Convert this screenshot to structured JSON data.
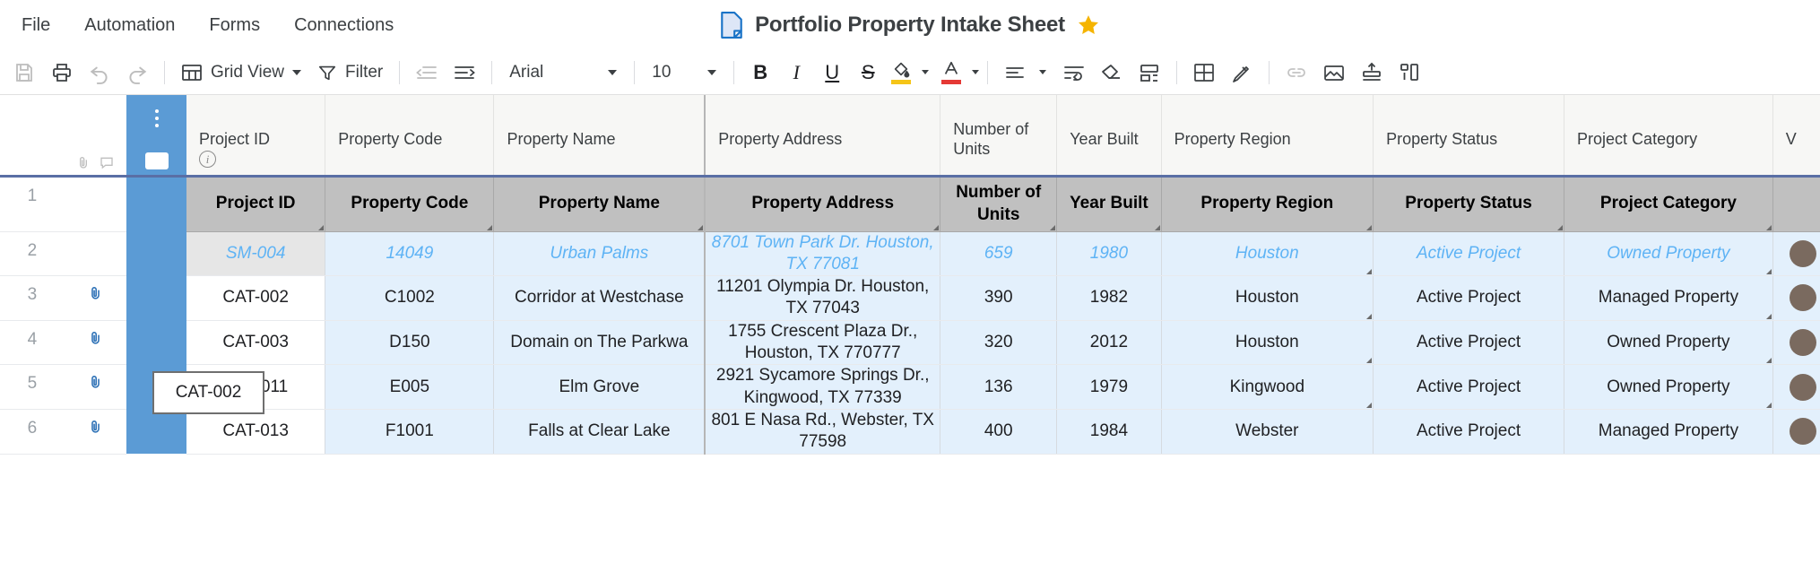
{
  "menu": {
    "items": [
      "File",
      "Automation",
      "Forms",
      "Connections"
    ]
  },
  "document": {
    "title": "Portfolio Property Intake Sheet",
    "icon": "document-icon",
    "starred_icon": "star-icon",
    "star_color": "#f5b400"
  },
  "toolbar": {
    "save_icon": "save-icon",
    "print_icon": "print-icon",
    "undo_icon": "undo-icon",
    "redo_icon": "redo-icon",
    "view_label": "Grid View",
    "view_icon": "grid-view-icon",
    "filter_label": "Filter",
    "filter_icon": "filter-icon",
    "indent_decrease_icon": "indent-decrease-icon",
    "indent_increase_icon": "indent-increase-icon",
    "font_family": "Arial",
    "font_size": "10",
    "bold_label": "B",
    "italic_label": "I",
    "underline_label": "U",
    "strikethrough_label": "S",
    "fill_color_icon": "fill-color-icon",
    "fill_color": "#f5c518",
    "text_color_icon": "text-color-icon",
    "text_color": "#e53935",
    "align_icon": "align-icon",
    "wrap_text_icon": "wrap-text-icon",
    "clear_format_icon": "clear-format-icon",
    "merge_cells_icon": "merge-cells-icon",
    "borders_icon": "borders-icon",
    "highlight_icon": "highlight-icon",
    "link_icon": "link-icon",
    "image_icon": "image-icon",
    "insert_row_icon": "insert-row-icon",
    "chart_icon": "chart-icon"
  },
  "grid": {
    "columns": [
      "Project ID",
      "Property Code",
      "Property Name",
      "Property Address",
      "Number of Units",
      "Year Built",
      "Property Region",
      "Property Status",
      "Project Category",
      "V"
    ],
    "row_numbers": [
      "1",
      "2",
      "3",
      "4",
      "5",
      "6"
    ],
    "attachment_icon": "attachment-icon",
    "rows": [
      {
        "type": "header",
        "cells": [
          "Project ID",
          "Property Code",
          "Property Name",
          "Property Address",
          "Number of Units",
          "Year Built",
          "Property Region",
          "Property Status",
          "Project Category",
          ""
        ]
      },
      {
        "type": "italic",
        "cells": [
          "SM-004",
          "14049",
          "Urban Palms",
          "8701 Town Park Dr. Houston, TX 77081",
          "659",
          "1980",
          "Houston",
          "Active Project",
          "Owned Property",
          ""
        ]
      },
      {
        "type": "normal",
        "cells": [
          "CAT-002",
          "C1002",
          "Corridor at Westchase",
          "11201 Olympia Dr. Houston, TX 77043",
          "390",
          "1982",
          "Houston",
          "Active Project",
          "Managed Property",
          ""
        ]
      },
      {
        "type": "normal",
        "cells": [
          "CAT-003",
          "D150",
          "Domain on The Parkwa",
          "1755 Crescent Plaza Dr., Houston, TX 770777",
          "320",
          "2012",
          "Houston",
          "Active Project",
          "Owned Property",
          ""
        ]
      },
      {
        "type": "normal",
        "cells": [
          "CAT-011",
          "E005",
          "Elm Grove",
          "2921 Sycamore Springs Dr., Kingwood, TX 77339",
          "136",
          "1979",
          "Kingwood",
          "Active Project",
          "Owned Property",
          ""
        ]
      },
      {
        "type": "normal",
        "cells": [
          "CAT-013",
          "F1001",
          "Falls at Clear Lake",
          "801 E Nasa Rd., Webster, TX 77598",
          "400",
          "1984",
          "Webster",
          "Active Project",
          "Managed Property",
          ""
        ]
      }
    ],
    "selected_cell": "CAT-002"
  }
}
